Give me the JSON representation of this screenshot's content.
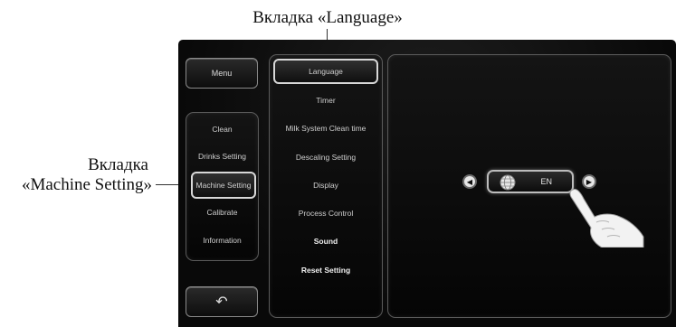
{
  "callouts": {
    "top": "Вкладка «Language»",
    "left_line1": "Вкладка",
    "left_line2": "«Machine Setting»"
  },
  "menu_button": "Menu",
  "sidebar": {
    "items": [
      {
        "label": "Clean",
        "selected": false
      },
      {
        "label": "Drinks Setting",
        "selected": false
      },
      {
        "label": "Machine Setting",
        "selected": true
      },
      {
        "label": "Calibrate",
        "selected": false
      },
      {
        "label": "Information",
        "selected": false
      }
    ]
  },
  "settings": {
    "items": [
      {
        "label": "Language",
        "selected": true,
        "bold": false
      },
      {
        "label": "Timer",
        "selected": false,
        "bold": false
      },
      {
        "label": "Milk System Clean time",
        "selected": false,
        "bold": false
      },
      {
        "label": "Descaling Setting",
        "selected": false,
        "bold": false
      },
      {
        "label": "Display",
        "selected": false,
        "bold": false
      },
      {
        "label": "Process Control",
        "selected": false,
        "bold": false
      },
      {
        "label": "Sound",
        "selected": false,
        "bold": true
      },
      {
        "label": "Reset Setting",
        "selected": false,
        "bold": true
      }
    ]
  },
  "language_selector": {
    "current": "EN",
    "prev_icon": "triangle-left-icon",
    "next_icon": "triangle-right-icon",
    "globe_icon": "globe-icon"
  },
  "back_icon": "back-arrow-icon",
  "colors": {
    "screen_bg": "#0b0b0b",
    "panel_border": "#5a5a5a",
    "text": "#dcdcdc"
  }
}
